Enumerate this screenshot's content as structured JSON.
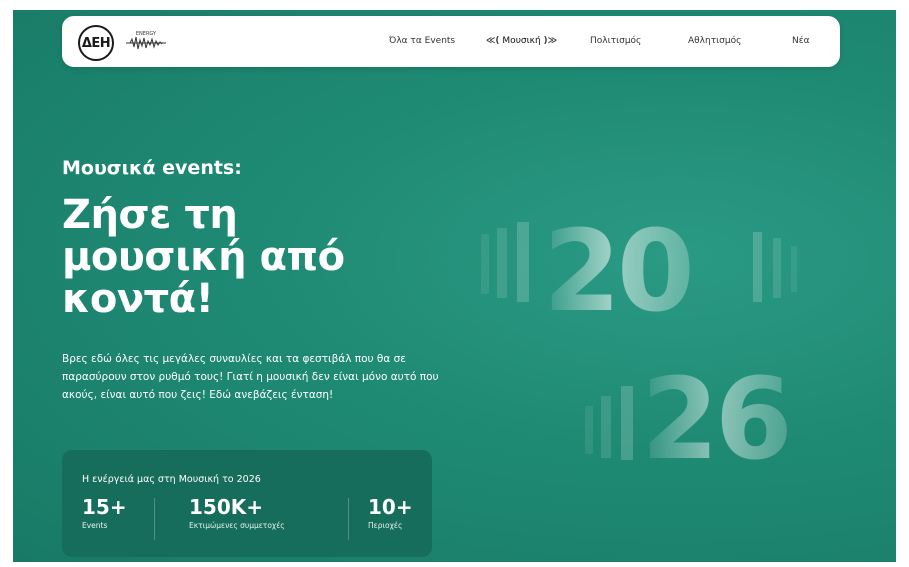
{
  "nav": {
    "logo_text": "ΔΕΗ",
    "energy_mark": "ENERGY",
    "items": [
      "Όλα τα Events",
      "Μουσική",
      "Πολιτισμός",
      "Αθλητισμός",
      "Νέα"
    ],
    "active_item": "Μουσική",
    "active_bracket_left": "≪(",
    "active_bracket_right": ")≫"
  },
  "hero": {
    "eyebrow": "Μουσικά events:",
    "headline_lines": [
      "Ζήσε τη",
      "μουσική από",
      "κοντά!"
    ],
    "intro": "Βρες εδώ όλες τις μεγάλες συναυλίες και τα φεστιβάλ που θα σε παρασύρουν στον ρυθμό τους! Γιατί η μουσική δεν είναι μόνο αυτό που ακούς, είναι αυτό που ζεις! Εδώ ανεβάζεις ένταση!"
  },
  "stats": {
    "title": "Η ενέργειά μας στη Μουσική το 2026",
    "items": [
      {
        "value": "15+",
        "label": "Events"
      },
      {
        "value": "150K+",
        "label": "Εκτιμώμενες συμμετοχές"
      },
      {
        "value": "10+",
        "label": "Περιοχές"
      }
    ]
  },
  "year_graphic": {
    "top": "20",
    "bottom": "26"
  },
  "colors": {
    "background": "#1f8a74",
    "card": "#166d5b",
    "navbar": "#ffffff",
    "text_light": "#ffffff"
  }
}
